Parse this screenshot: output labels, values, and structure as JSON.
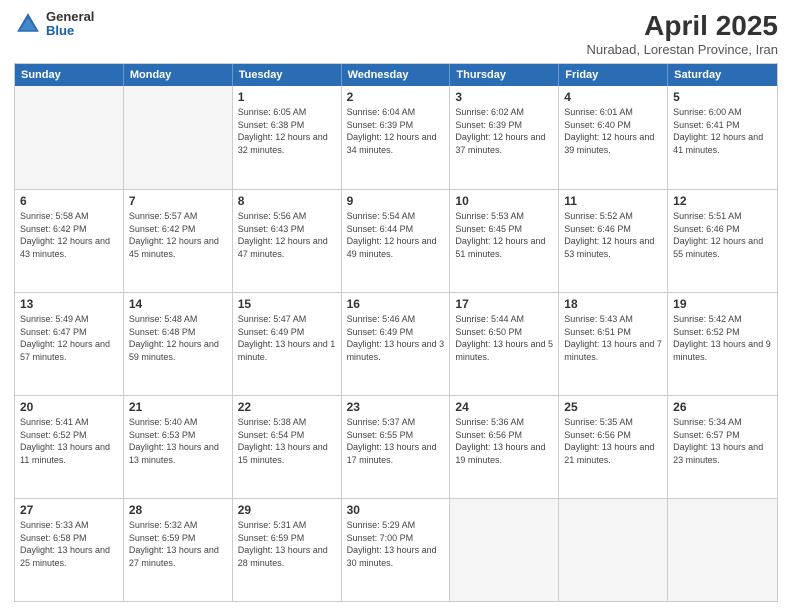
{
  "logo": {
    "general": "General",
    "blue": "Blue"
  },
  "title": "April 2025",
  "subtitle": "Nurabad, Lorestan Province, Iran",
  "weekdays": [
    "Sunday",
    "Monday",
    "Tuesday",
    "Wednesday",
    "Thursday",
    "Friday",
    "Saturday"
  ],
  "rows": [
    [
      {
        "day": "",
        "sunrise": "",
        "sunset": "",
        "daylight": ""
      },
      {
        "day": "",
        "sunrise": "",
        "sunset": "",
        "daylight": ""
      },
      {
        "day": "1",
        "sunrise": "Sunrise: 6:05 AM",
        "sunset": "Sunset: 6:38 PM",
        "daylight": "Daylight: 12 hours and 32 minutes."
      },
      {
        "day": "2",
        "sunrise": "Sunrise: 6:04 AM",
        "sunset": "Sunset: 6:39 PM",
        "daylight": "Daylight: 12 hours and 34 minutes."
      },
      {
        "day": "3",
        "sunrise": "Sunrise: 6:02 AM",
        "sunset": "Sunset: 6:39 PM",
        "daylight": "Daylight: 12 hours and 37 minutes."
      },
      {
        "day": "4",
        "sunrise": "Sunrise: 6:01 AM",
        "sunset": "Sunset: 6:40 PM",
        "daylight": "Daylight: 12 hours and 39 minutes."
      },
      {
        "day": "5",
        "sunrise": "Sunrise: 6:00 AM",
        "sunset": "Sunset: 6:41 PM",
        "daylight": "Daylight: 12 hours and 41 minutes."
      }
    ],
    [
      {
        "day": "6",
        "sunrise": "Sunrise: 5:58 AM",
        "sunset": "Sunset: 6:42 PM",
        "daylight": "Daylight: 12 hours and 43 minutes."
      },
      {
        "day": "7",
        "sunrise": "Sunrise: 5:57 AM",
        "sunset": "Sunset: 6:42 PM",
        "daylight": "Daylight: 12 hours and 45 minutes."
      },
      {
        "day": "8",
        "sunrise": "Sunrise: 5:56 AM",
        "sunset": "Sunset: 6:43 PM",
        "daylight": "Daylight: 12 hours and 47 minutes."
      },
      {
        "day": "9",
        "sunrise": "Sunrise: 5:54 AM",
        "sunset": "Sunset: 6:44 PM",
        "daylight": "Daylight: 12 hours and 49 minutes."
      },
      {
        "day": "10",
        "sunrise": "Sunrise: 5:53 AM",
        "sunset": "Sunset: 6:45 PM",
        "daylight": "Daylight: 12 hours and 51 minutes."
      },
      {
        "day": "11",
        "sunrise": "Sunrise: 5:52 AM",
        "sunset": "Sunset: 6:46 PM",
        "daylight": "Daylight: 12 hours and 53 minutes."
      },
      {
        "day": "12",
        "sunrise": "Sunrise: 5:51 AM",
        "sunset": "Sunset: 6:46 PM",
        "daylight": "Daylight: 12 hours and 55 minutes."
      }
    ],
    [
      {
        "day": "13",
        "sunrise": "Sunrise: 5:49 AM",
        "sunset": "Sunset: 6:47 PM",
        "daylight": "Daylight: 12 hours and 57 minutes."
      },
      {
        "day": "14",
        "sunrise": "Sunrise: 5:48 AM",
        "sunset": "Sunset: 6:48 PM",
        "daylight": "Daylight: 12 hours and 59 minutes."
      },
      {
        "day": "15",
        "sunrise": "Sunrise: 5:47 AM",
        "sunset": "Sunset: 6:49 PM",
        "daylight": "Daylight: 13 hours and 1 minute."
      },
      {
        "day": "16",
        "sunrise": "Sunrise: 5:46 AM",
        "sunset": "Sunset: 6:49 PM",
        "daylight": "Daylight: 13 hours and 3 minutes."
      },
      {
        "day": "17",
        "sunrise": "Sunrise: 5:44 AM",
        "sunset": "Sunset: 6:50 PM",
        "daylight": "Daylight: 13 hours and 5 minutes."
      },
      {
        "day": "18",
        "sunrise": "Sunrise: 5:43 AM",
        "sunset": "Sunset: 6:51 PM",
        "daylight": "Daylight: 13 hours and 7 minutes."
      },
      {
        "day": "19",
        "sunrise": "Sunrise: 5:42 AM",
        "sunset": "Sunset: 6:52 PM",
        "daylight": "Daylight: 13 hours and 9 minutes."
      }
    ],
    [
      {
        "day": "20",
        "sunrise": "Sunrise: 5:41 AM",
        "sunset": "Sunset: 6:52 PM",
        "daylight": "Daylight: 13 hours and 11 minutes."
      },
      {
        "day": "21",
        "sunrise": "Sunrise: 5:40 AM",
        "sunset": "Sunset: 6:53 PM",
        "daylight": "Daylight: 13 hours and 13 minutes."
      },
      {
        "day": "22",
        "sunrise": "Sunrise: 5:38 AM",
        "sunset": "Sunset: 6:54 PM",
        "daylight": "Daylight: 13 hours and 15 minutes."
      },
      {
        "day": "23",
        "sunrise": "Sunrise: 5:37 AM",
        "sunset": "Sunset: 6:55 PM",
        "daylight": "Daylight: 13 hours and 17 minutes."
      },
      {
        "day": "24",
        "sunrise": "Sunrise: 5:36 AM",
        "sunset": "Sunset: 6:56 PM",
        "daylight": "Daylight: 13 hours and 19 minutes."
      },
      {
        "day": "25",
        "sunrise": "Sunrise: 5:35 AM",
        "sunset": "Sunset: 6:56 PM",
        "daylight": "Daylight: 13 hours and 21 minutes."
      },
      {
        "day": "26",
        "sunrise": "Sunrise: 5:34 AM",
        "sunset": "Sunset: 6:57 PM",
        "daylight": "Daylight: 13 hours and 23 minutes."
      }
    ],
    [
      {
        "day": "27",
        "sunrise": "Sunrise: 5:33 AM",
        "sunset": "Sunset: 6:58 PM",
        "daylight": "Daylight: 13 hours and 25 minutes."
      },
      {
        "day": "28",
        "sunrise": "Sunrise: 5:32 AM",
        "sunset": "Sunset: 6:59 PM",
        "daylight": "Daylight: 13 hours and 27 minutes."
      },
      {
        "day": "29",
        "sunrise": "Sunrise: 5:31 AM",
        "sunset": "Sunset: 6:59 PM",
        "daylight": "Daylight: 13 hours and 28 minutes."
      },
      {
        "day": "30",
        "sunrise": "Sunrise: 5:29 AM",
        "sunset": "Sunset: 7:00 PM",
        "daylight": "Daylight: 13 hours and 30 minutes."
      },
      {
        "day": "",
        "sunrise": "",
        "sunset": "",
        "daylight": ""
      },
      {
        "day": "",
        "sunrise": "",
        "sunset": "",
        "daylight": ""
      },
      {
        "day": "",
        "sunrise": "",
        "sunset": "",
        "daylight": ""
      }
    ]
  ]
}
